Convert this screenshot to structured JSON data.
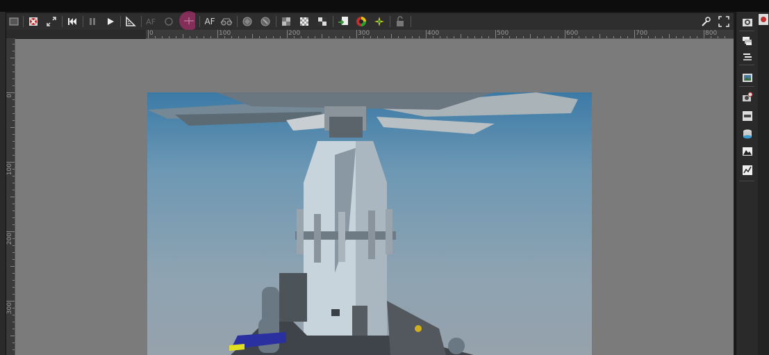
{
  "toolbar": {
    "af_label": "AF",
    "af_disabled_label": "AF"
  },
  "ruler": {
    "h_labels": [
      "0",
      "100",
      "200",
      "300",
      "400",
      "500",
      "600",
      "700",
      "800"
    ],
    "v_labels": [
      "0",
      "100",
      "200",
      "300"
    ]
  },
  "icons": {
    "toolbar": [
      "window-icon",
      "cancel-render-icon",
      "expand-icon",
      "skip-back-icon",
      "pause-icon",
      "play-icon",
      "ruler-icon",
      "auto-focus-disabled-icon",
      "refresh-disabled-icon",
      "pick-focus-icon",
      "auto-focus-icon",
      "stereo-glasses-icon",
      "region-render-icon",
      "region-render-alt-icon",
      "alpha-icon",
      "checker-icon",
      "grid-icon",
      "import-icon",
      "color-wheel-icon",
      "sparkle-icon",
      "lock-icon",
      "wrench-icon",
      "fullscreen-icon"
    ],
    "rightpanel": [
      "camera-settings-icon",
      "layers-icon",
      "passes-icon",
      "image-icon",
      "camera-icon",
      "film-icon",
      "database-icon",
      "picture-icon",
      "graph-icon"
    ]
  },
  "colors": {
    "background": "#1b1b1b",
    "toolbar": "#2e2e2e",
    "canvas": "#7b7b7b",
    "sky_top": "#3b7aa6",
    "highlight": "#a0306a"
  }
}
